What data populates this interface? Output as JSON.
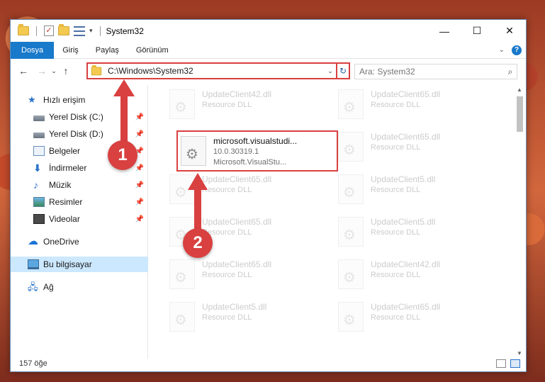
{
  "window": {
    "title": "System32",
    "controls": {
      "minimize": "—",
      "maximize": "☐",
      "close": "✕"
    }
  },
  "ribbon": {
    "tabs": [
      {
        "label": "Dosya"
      },
      {
        "label": "Giriş"
      },
      {
        "label": "Paylaş"
      },
      {
        "label": "Görünüm"
      }
    ],
    "help": "?"
  },
  "navigation": {
    "back": "←",
    "forward": "→",
    "recent": "⌄",
    "up": "↑",
    "address": "C:\\Windows\\System32",
    "refresh": "↻",
    "search_placeholder": "Ara: System32"
  },
  "sidebar": {
    "quick_access": "Hızlı erişim",
    "items": [
      {
        "label": "Yerel Disk (C:)",
        "icon": "drive-icon"
      },
      {
        "label": "Yerel Disk (D:)",
        "icon": "drive-icon"
      },
      {
        "label": "Belgeler",
        "icon": "documents-icon"
      },
      {
        "label": "İndirmeler",
        "icon": "downloads-icon"
      },
      {
        "label": "Müzik",
        "icon": "music-icon"
      },
      {
        "label": "Resimler",
        "icon": "pictures-icon"
      },
      {
        "label": "Videolar",
        "icon": "videos-icon"
      }
    ],
    "onedrive": "OneDrive",
    "this_pc": "Bu bilgisayar",
    "network": "Ağ"
  },
  "files": [
    {
      "name": "UpdateClient42.dll",
      "type": "Resource DLL"
    },
    {
      "name": "UpdateClient65.dll",
      "type": "Resource DLL"
    },
    {
      "name": "microsoft.visualstudi...",
      "version": "10.0.30319.1",
      "type": "Microsoft.VisualStu..."
    },
    {
      "name": "UpdateClient65.dll",
      "type": "Resource DLL"
    },
    {
      "name": "UpdateClient65.dll",
      "type": "Resource DLL"
    },
    {
      "name": "UpdateClient5.dll",
      "type": "Resource DLL"
    },
    {
      "name": "UpdateClient65.dll",
      "type": "Resource DLL"
    },
    {
      "name": "UpdateClient5.dll",
      "type": "Resource DLL"
    },
    {
      "name": "UpdateClient65.dll",
      "type": "Resource DLL"
    },
    {
      "name": "UpdateClient42.dll",
      "type": "Resource DLL"
    },
    {
      "name": "UpdateClient5.dll",
      "type": "Resource DLL"
    },
    {
      "name": "UpdateClient65.dll",
      "type": "Resource DLL"
    }
  ],
  "status": {
    "count": "157 öğe"
  },
  "annotations": {
    "step1": "1",
    "step2": "2"
  },
  "colors": {
    "highlight": "#d94040",
    "accent": "#1979ca",
    "selection": "#cce8ff"
  }
}
